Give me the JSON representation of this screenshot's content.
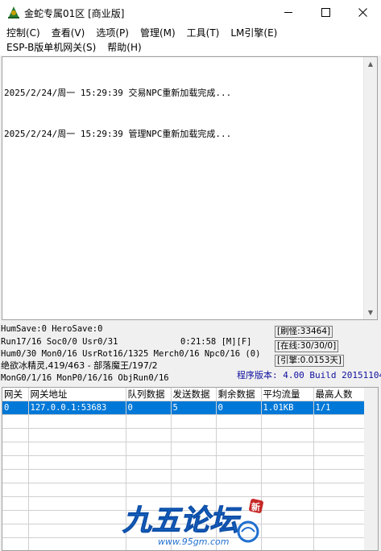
{
  "window": {
    "title": "金蛇专属01区 [商业版]",
    "minimize_glyph": "—",
    "maximize_glyph": "☐",
    "close_glyph": "✕"
  },
  "menu": {
    "row1": [
      "控制(C)",
      "查看(V)",
      "选项(P)",
      "管理(M)",
      "工具(T)",
      "LM引擎(E)"
    ],
    "row2": [
      "ESP-B版单机网关(S)",
      "帮助(H)"
    ]
  },
  "log": {
    "lines": [
      "2025/2/24/周一 15:29:39 交易NPC重新加载完成...",
      "2025/2/24/周一 15:29:39 管理NPC重新加载完成..."
    ]
  },
  "status": {
    "line1": "HumSave:0 HeroSave:0",
    "line2": "Run17/16 Soc0/0 Usr0/31",
    "time": "0:21:58 [M][F]",
    "line3": "Hum0/30 Mon0/16 UsrRot16/1325 Merch0/16 Npc0/16 (0)",
    "line4": "绝欲冰精灵,419/463 - 部落魔王/197/2",
    "line5": "MonG0/1/16 MonP0/16/16 ObjRun0/16",
    "refresh_monsters": "[刷怪:33464]",
    "online": "[在线:30/30/0]",
    "engine": "[引擎:0.0153天]",
    "version": "程序版本: 4.00 Build 20151104"
  },
  "grid": {
    "columns": [
      "网关",
      "网关地址",
      "队列数据",
      "发送数据",
      "剩余数据",
      "平均流量",
      "最高人数"
    ],
    "rows": [
      [
        "0",
        "127.0.0.1:53683",
        "0",
        "5",
        "0",
        "1.01KB",
        "1/1"
      ]
    ]
  },
  "watermark": {
    "brand": "九五论坛",
    "url": "www.95gm.com",
    "badge": "新"
  },
  "colors": {
    "selection": "#0078d7",
    "version_text": "#1010a0",
    "watermark_blue": "#1f6fd0"
  }
}
